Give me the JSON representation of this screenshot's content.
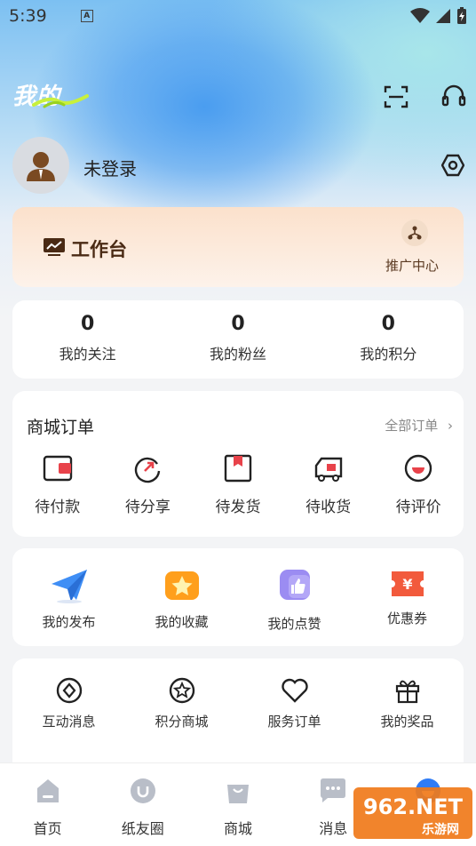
{
  "status_bar": {
    "time": "5:39",
    "sim_label": "A"
  },
  "header": {
    "title": "我的"
  },
  "profile": {
    "login_status": "未登录"
  },
  "workbench": {
    "title": "工作台",
    "promo_label": "推广中心"
  },
  "stats": [
    {
      "value": "0",
      "label": "我的关注"
    },
    {
      "value": "0",
      "label": "我的粉丝"
    },
    {
      "value": "0",
      "label": "我的积分"
    }
  ],
  "orders": {
    "title": "商城订单",
    "all_label": "全部订单",
    "items": [
      {
        "label": "待付款",
        "icon": "wallet-icon"
      },
      {
        "label": "待分享",
        "icon": "share-icon"
      },
      {
        "label": "待发货",
        "icon": "package-icon"
      },
      {
        "label": "待收货",
        "icon": "truck-icon"
      },
      {
        "label": "待评价",
        "icon": "smile-icon"
      }
    ]
  },
  "tools": [
    {
      "label": "我的发布",
      "icon": "paper-plane-icon"
    },
    {
      "label": "我的收藏",
      "icon": "star-icon"
    },
    {
      "label": "我的点赞",
      "icon": "thumbs-up-icon"
    },
    {
      "label": "优惠券",
      "icon": "coupon-icon"
    }
  ],
  "services": [
    {
      "label": "互动消息",
      "icon": "diamond-chat-icon"
    },
    {
      "label": "积分商城",
      "icon": "star-circle-icon"
    },
    {
      "label": "服务订单",
      "icon": "heart-icon"
    },
    {
      "label": "我的奖品",
      "icon": "gift-icon"
    }
  ],
  "tabbar": [
    {
      "label": "首页",
      "icon": "home-icon"
    },
    {
      "label": "纸友圈",
      "icon": "circle-icon"
    },
    {
      "label": "商城",
      "icon": "shopping-bag-icon"
    },
    {
      "label": "消息",
      "icon": "message-icon"
    },
    {
      "label": "",
      "icon": "profile-icon"
    }
  ],
  "watermark": {
    "text": "962.NET",
    "sub": "乐游网"
  },
  "colors": {
    "accent_blue": "#2f7cf6",
    "order_red": "#e8424a",
    "workbench_brown": "#4a2a14"
  }
}
